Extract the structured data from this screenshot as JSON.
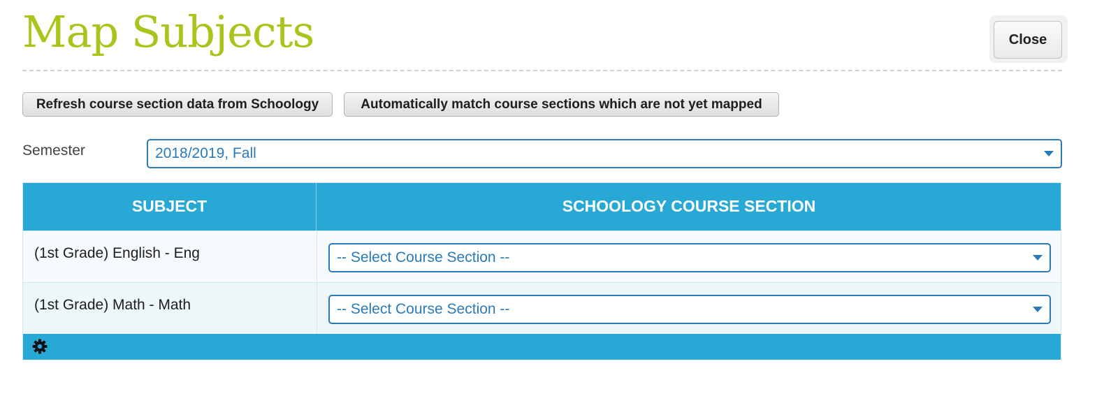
{
  "header": {
    "title": "Map Subjects",
    "close_label": "Close"
  },
  "actions": {
    "refresh_label": "Refresh course section data from Schoology",
    "auto_match_label": "Automatically match course sections which are not yet mapped"
  },
  "semester": {
    "label": "Semester",
    "selected": "2018/2019, Fall"
  },
  "table": {
    "headers": {
      "subject": "SUBJECT",
      "course_section": "SCHOOLOGY COURSE SECTION"
    },
    "rows": [
      {
        "subject": "(1st Grade) English - Eng",
        "course_section": "-- Select Course Section --"
      },
      {
        "subject": "(1st Grade) Math - Math",
        "course_section": "-- Select Course Section --"
      }
    ],
    "footer_icon": "gear-icon"
  },
  "colors": {
    "title": "#a7c61b",
    "accent": "#28a9d5",
    "select_text": "#2a7ab8"
  }
}
